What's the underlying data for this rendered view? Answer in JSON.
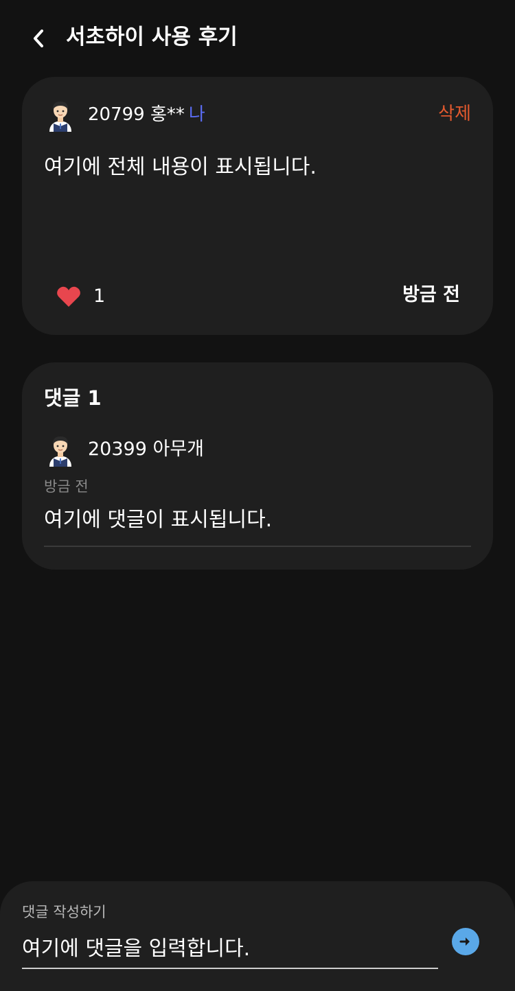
{
  "header": {
    "title": "서초하이 사용 후기",
    "back_icon": "chevron-left-icon"
  },
  "post": {
    "author": "20799 홍**",
    "me_tag": "나",
    "delete_label": "삭제",
    "body": "여기에 전체 내용이 표시됩니다.",
    "like_count": "1",
    "time": "방금 전",
    "like_icon": "heart-icon",
    "avatar_icon": "student-avatar-icon"
  },
  "comments": {
    "title": "댓글 1",
    "items": [
      {
        "author": "20399 아무개",
        "time": "방금 전",
        "body": "여기에 댓글이 표시됩니다.",
        "avatar_icon": "student-avatar-icon"
      }
    ]
  },
  "composer": {
    "label": "댓글 작성하기",
    "placeholder": "여기에 댓글을 입력합니다.",
    "send_icon": "arrow-right-icon"
  },
  "colors": {
    "background": "#121212",
    "card": "#1f1f1f",
    "delete": "#e2592e",
    "me_tag": "#5b6df6",
    "heart": "#e8464e",
    "send": "#5aa8e8"
  }
}
